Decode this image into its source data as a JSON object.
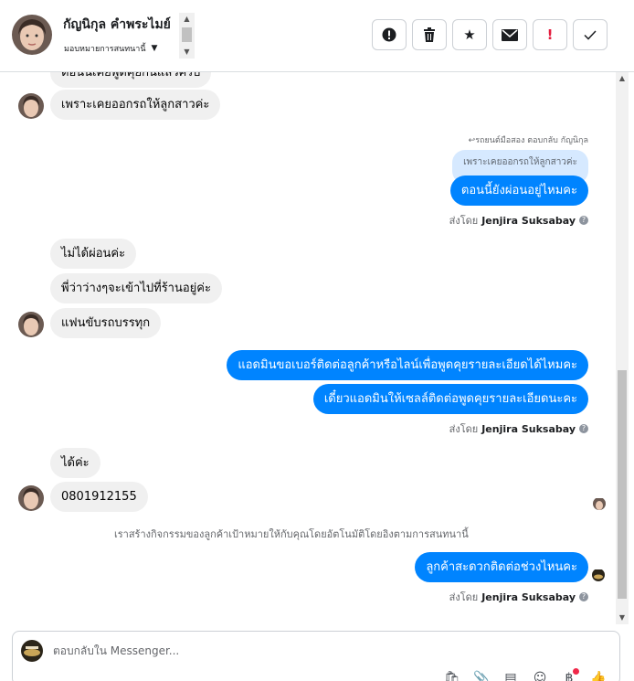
{
  "header": {
    "name": "กัญนิกุล คำพระไมย์",
    "assign_label": "มอบหมายการสนทนานี้",
    "actions": [
      {
        "icon": "alert-circle-icon",
        "glyph": "❗"
      },
      {
        "icon": "trash-icon",
        "glyph": "🗑"
      },
      {
        "icon": "star-icon",
        "glyph": "★"
      },
      {
        "icon": "envelope-icon",
        "glyph": "✉"
      },
      {
        "icon": "exclamation-icon",
        "glyph": "!"
      },
      {
        "icon": "check-icon",
        "glyph": "✓"
      }
    ]
  },
  "messages": {
    "m0_partial": "ตอนนี้เคยพูดคุยกันแล้วครับ",
    "m1": "เพราะเคยออกรถให้ลูกสาวค่ะ",
    "reply_label": "↩รถยนต์มือสอง ตอบกลับ กัญนิกุล",
    "reply_quote": "เพราะเคยออกรถให้ลูกสาวค่ะ",
    "m2": "ตอนนี้ยังผ่อนอยู่ไหมคะ",
    "sent_by_1": {
      "prefix": "ส่งโดย",
      "name": "Jenjira Suksabay"
    },
    "m3": "ไม่ได้ผ่อนค่ะ",
    "m4": "พี่ว่าว่างๆจะเข้าไปที่ร้านอยู่ค่ะ",
    "m5": "แฟนขับรถบรรทุก",
    "m6": "แอดมินขอเบอร์ติดต่อลูกค้าหรือไลน์เพื่อพูดคุยรายละเอียดได้ไหมคะ",
    "m7": "เดี๋ยวแอดมินให้เซลล์ติดต่อพูดคุยรายละเอียดนะคะ",
    "sent_by_2": {
      "prefix": "ส่งโดย",
      "name": "Jenjira Suksabay"
    },
    "m8": "ได้ค่ะ",
    "m9": "0801912155",
    "system": "เราสร้างกิจกรรมของลูกค้าเป้าหมายให้กับคุณโดยอัตโนมัติโดยอิงตามการสนทนานี้",
    "m10": "ลูกค้าสะดวกติดต่อช่วงไหนคะ",
    "sent_by_3": {
      "prefix": "ส่งโดย",
      "name": "Jenjira Suksabay"
    }
  },
  "composer": {
    "placeholder": "ตอบกลับใน Messenger..."
  },
  "tools": [
    {
      "icon": "shopping-bag-icon",
      "glyph": "🛍"
    },
    {
      "icon": "paperclip-icon",
      "glyph": "📎"
    },
    {
      "icon": "saved-replies-icon",
      "glyph": "▤"
    },
    {
      "icon": "emoji-icon",
      "glyph": "☺"
    },
    {
      "icon": "baht-icon",
      "glyph": "฿"
    },
    {
      "icon": "thumbs-up-icon",
      "glyph": "👍"
    }
  ]
}
